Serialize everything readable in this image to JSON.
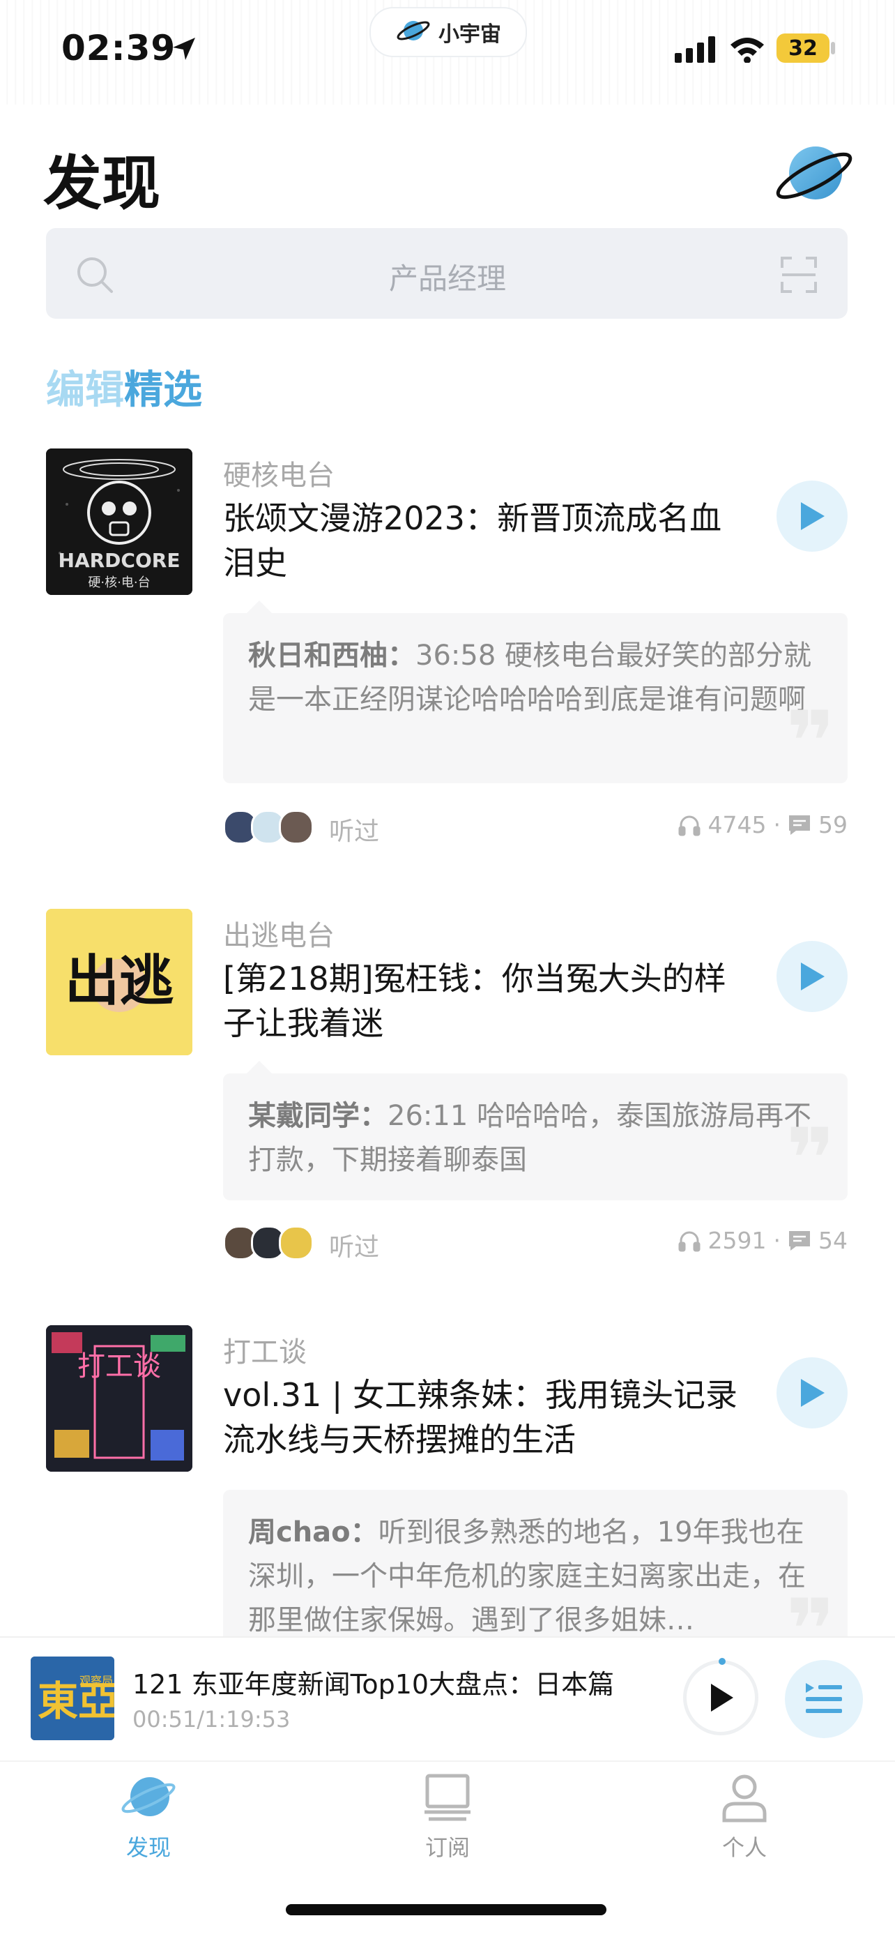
{
  "status_bar": {
    "time": "02:39",
    "island_label": "小宇宙",
    "battery": "32"
  },
  "header": {
    "title": "发现"
  },
  "search": {
    "placeholder": "产品经理"
  },
  "section": {
    "title_part1": "编辑",
    "title_part2": "精选"
  },
  "feed": [
    {
      "podcast": "硬核电台",
      "title": "张颂文漫游2023：新晋顶流成名血泪史",
      "comment_author": "秋日和西柚：",
      "comment_text": "36:58 硬核电台最好笑的部分就是一本正经阴谋论哈哈哈哈到底是谁有问题啊",
      "listened_label": "听过",
      "plays": "4745",
      "comments": "59"
    },
    {
      "podcast": "出逃电台",
      "title": "[第218期]冤枉钱：你当冤大头的样子让我着迷",
      "comment_author": "某戴同学：",
      "comment_text": "26:11 哈哈哈哈，泰国旅游局再不打款，下期接着聊泰国",
      "listened_label": "听过",
      "plays": "2591",
      "comments": "54"
    },
    {
      "podcast": "打工谈",
      "title": "vol.31 | 女工辣条妹：我用镜头记录流水线与天桥摆摊的生活",
      "comment_author": "周chao：",
      "comment_text": "听到很多熟悉的地名，19年我也在深圳，一个中年危机的家庭主妇离家出走，在那里做住家保姆。遇到了很多姐妹…"
    }
  ],
  "covers": {
    "hardcore_text": "HARDCORE",
    "hardcore_sub": "硬·核·电·台",
    "escape_text": "出逃",
    "dagong_text": "打工谈",
    "mini_text": "東亞",
    "mini_sub": "观察局"
  },
  "player": {
    "title": "121 东亚年度新闻Top10大盘点：日本篇",
    "time": "00:51/1:19:53"
  },
  "tabs": [
    {
      "label": "发现",
      "active": true
    },
    {
      "label": "订阅",
      "active": false
    },
    {
      "label": "个人",
      "active": false
    }
  ],
  "colors": {
    "accent": "#4aa7dd",
    "accent_light": "#a8d9f2",
    "play_bg": "#e4f3fb",
    "battery": "#f3c93a"
  }
}
